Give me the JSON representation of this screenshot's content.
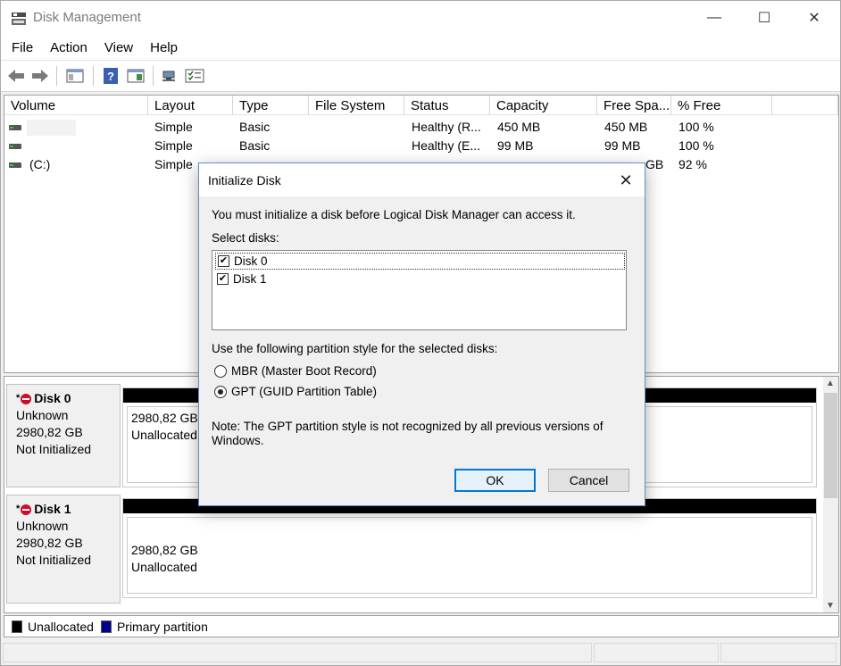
{
  "window": {
    "title": "Disk Management",
    "minimize_glyph": "—",
    "maximize_glyph": "☐",
    "close_glyph": "✕"
  },
  "menu": [
    "File",
    "Action",
    "View",
    "Help"
  ],
  "toolbar": {
    "icons": [
      "back-icon",
      "forward-icon",
      "show-hide-console-tree-icon",
      "help-icon",
      "properties-icon",
      "connect-icon",
      "checklist-icon"
    ],
    "help_glyph": "?"
  },
  "volume_list": {
    "columns": [
      "Volume",
      "Layout",
      "Type",
      "File System",
      "Status",
      "Capacity",
      "Free Spa...",
      "% Free"
    ],
    "rows": [
      {
        "volume": "",
        "layout": "Simple",
        "type": "Basic",
        "fs": "",
        "status": "Healthy (R...",
        "capacity": "450 MB",
        "free": "450 MB",
        "pct": "100 %"
      },
      {
        "volume": "",
        "layout": "Simple",
        "type": "Basic",
        "fs": "",
        "status": "Healthy (E...",
        "capacity": "99 MB",
        "free": "99 MB",
        "pct": "100 %"
      },
      {
        "volume": "(C:)",
        "layout": "Simple",
        "type": "",
        "fs": "",
        "status": "",
        "capacity": "",
        "free": "GB",
        "pct": "92 %"
      }
    ]
  },
  "disks": [
    {
      "name": "Disk 0",
      "type": "Unknown",
      "size": "2980,82 GB",
      "state": "Not Initialized",
      "part_size": "2980,82 GB",
      "part_label": "Unallocated"
    },
    {
      "name": "Disk 1",
      "type": "Unknown",
      "size": "2980,82 GB",
      "state": "Not Initialized",
      "part_size": "2980,82 GB",
      "part_label": "Unallocated"
    }
  ],
  "legend": {
    "unallocated": "Unallocated",
    "primary": "Primary partition",
    "unallocated_color": "#000000",
    "primary_color": "#00008b"
  },
  "dialog": {
    "title": "Initialize Disk",
    "close_glyph": "✕",
    "intro": "You must initialize a disk before Logical Disk Manager can access it.",
    "select_label": "Select disks:",
    "disks": [
      {
        "label": "Disk 0",
        "checked": true
      },
      {
        "label": "Disk 1",
        "checked": true
      }
    ],
    "check_glyph": "✔",
    "style_label": "Use the following partition style for the selected disks:",
    "mbr_label": "MBR (Master Boot Record)",
    "gpt_label": "GPT (GUID Partition Table)",
    "selected_style": "GPT",
    "note_line1": "Note: The GPT partition style is not recognized by all previous versions of",
    "note_line2": "Windows.",
    "ok_label": "OK",
    "cancel_label": "Cancel"
  }
}
